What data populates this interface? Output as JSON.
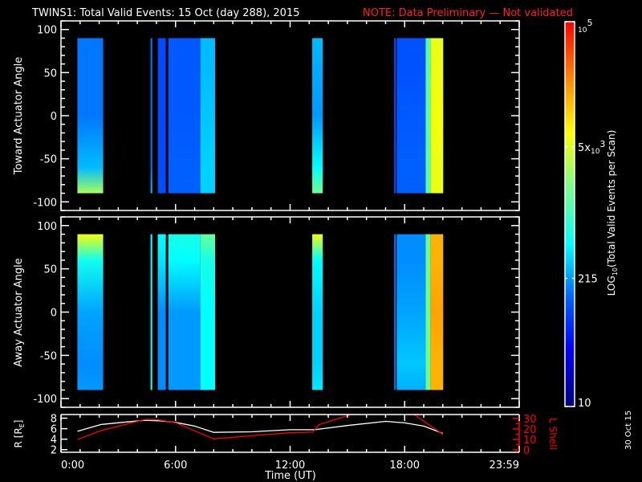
{
  "title": {
    "main": "TWINS1: Total Valid Events: 15 Oct (day 288), 2015",
    "note": "NOTE: Data Preliminary — Not validated",
    "note_color": "#ff2020"
  },
  "side_date": "30 Oct 15",
  "chart_data": [
    {
      "type": "heatmap",
      "panel": "toward",
      "ylabel": "Toward Actuator Angle",
      "ylim": [
        -110,
        110
      ],
      "yticks": [
        "100",
        "50",
        "0",
        "-50",
        "-100"
      ],
      "ytick_values": [
        100,
        50,
        0,
        -50,
        -100
      ],
      "xlim_hours": [
        0,
        24
      ],
      "profile_angles": [
        90,
        60,
        0,
        -60,
        -90
      ],
      "blocks": [
        {
          "start": 0.86,
          "end": 2.21,
          "levels": [
            0.3,
            0.3,
            0.3,
            0.36,
            0.62
          ]
        },
        {
          "start": 4.69,
          "end": 4.78,
          "levels": [
            0.3,
            0.3,
            0.3,
            0.3,
            0.36
          ]
        },
        {
          "start": 5.07,
          "end": 5.49,
          "levels": [
            0.25,
            0.25,
            0.25,
            0.25,
            0.26
          ]
        },
        {
          "start": 5.62,
          "end": 7.3,
          "levels": [
            0.27,
            0.27,
            0.27,
            0.28,
            0.28
          ]
        },
        {
          "start": 7.3,
          "end": 8.07,
          "levels": [
            0.36,
            0.36,
            0.37,
            0.38,
            0.38
          ]
        },
        {
          "start": 13.16,
          "end": 13.71,
          "levels": [
            0.36,
            0.35,
            0.33,
            0.42,
            0.56
          ]
        },
        {
          "start": 17.45,
          "end": 17.53,
          "levels": [
            0.26,
            0.26,
            0.26,
            0.26,
            0.26
          ]
        },
        {
          "start": 17.58,
          "end": 19.1,
          "levels": [
            0.26,
            0.26,
            0.27,
            0.28,
            0.28
          ]
        },
        {
          "start": 19.1,
          "end": 19.35,
          "levels": [
            0.52,
            0.52,
            0.52,
            0.52,
            0.52
          ]
        },
        {
          "start": 19.35,
          "end": 20.02,
          "levels": [
            0.69,
            0.69,
            0.7,
            0.69,
            0.69
          ]
        }
      ]
    },
    {
      "type": "heatmap",
      "panel": "away",
      "ylabel": "Away Actuator Angle",
      "ylim": [
        -110,
        110
      ],
      "yticks": [
        "100",
        "50",
        "0",
        "-50",
        "-100"
      ],
      "ytick_values": [
        100,
        50,
        0,
        -50,
        -100
      ],
      "xlim_hours": [
        0,
        24
      ],
      "profile_angles": [
        90,
        60,
        0,
        -60,
        -90
      ],
      "blocks": [
        {
          "start": 0.86,
          "end": 2.21,
          "levels": [
            0.7,
            0.44,
            0.34,
            0.32,
            0.33
          ]
        },
        {
          "start": 4.69,
          "end": 4.78,
          "levels": [
            0.42,
            0.42,
            0.42,
            0.42,
            0.45
          ]
        },
        {
          "start": 5.07,
          "end": 5.49,
          "levels": [
            0.42,
            0.4,
            0.32,
            0.32,
            0.32
          ]
        },
        {
          "start": 5.62,
          "end": 7.3,
          "levels": [
            0.45,
            0.42,
            0.33,
            0.33,
            0.33
          ]
        },
        {
          "start": 7.3,
          "end": 8.07,
          "levels": [
            0.55,
            0.45,
            0.42,
            0.42,
            0.42
          ]
        },
        {
          "start": 13.16,
          "end": 13.71,
          "levels": [
            0.7,
            0.42,
            0.38,
            0.38,
            0.4
          ]
        },
        {
          "start": 17.45,
          "end": 17.53,
          "levels": [
            0.3,
            0.3,
            0.3,
            0.3,
            0.3
          ]
        },
        {
          "start": 17.58,
          "end": 19.1,
          "levels": [
            0.32,
            0.32,
            0.34,
            0.37,
            0.35
          ]
        },
        {
          "start": 19.1,
          "end": 19.35,
          "levels": [
            0.55,
            0.55,
            0.55,
            0.55,
            0.55
          ]
        },
        {
          "start": 19.35,
          "end": 20.02,
          "levels": [
            0.8,
            0.8,
            0.82,
            0.8,
            0.8
          ]
        }
      ]
    },
    {
      "type": "line",
      "panel": "orbit",
      "xlabel": "Time (UT)",
      "xticks": [
        "0:00",
        "6:00",
        "12:00",
        "18:00",
        "23:59"
      ],
      "xtick_hours": [
        0,
        6,
        12,
        18,
        24
      ],
      "left_axis": {
        "label": "R [R",
        "label_sub": "E",
        "label_end": "]",
        "ticks": [
          "8",
          "6",
          "4",
          "2"
        ],
        "tick_values": [
          8,
          6,
          4,
          2
        ],
        "ylim": [
          1.5,
          8.7
        ]
      },
      "right_axis": {
        "label": "L Shell",
        "ticks": [
          "30",
          "20",
          "10",
          "0"
        ],
        "tick_values": [
          30,
          20,
          10,
          0
        ],
        "ylim": [
          -2.3,
          33.8
        ],
        "color": "#ff0000"
      },
      "series": [
        {
          "name": "R",
          "color": "#ffffff",
          "axis": "left",
          "x": [
            0.86,
            2.1,
            3.2,
            4.4,
            5.2,
            6.0,
            7.0,
            8.0,
            10.0,
            12.0,
            13.3,
            15.0,
            17.0,
            18.0,
            19.0,
            20.0
          ],
          "y": [
            5.5,
            6.8,
            7.2,
            7.6,
            7.5,
            7.2,
            6.5,
            5.3,
            5.4,
            5.8,
            5.8,
            6.6,
            7.4,
            7.1,
            6.5,
            5.1
          ]
        },
        {
          "name": "L Shell",
          "color": "#ff0000",
          "axis": "right",
          "segments": [
            {
              "x": [
                0.86,
                2.1,
                4.4,
                5.0,
                6.0,
                8.0,
                10.0,
                12.0,
                13.19,
                13.5,
                15.2,
                16.0
              ],
              "y": [
                9.8,
                18.5,
                29.0,
                29.0,
                26.0,
                10.5,
                13.5,
                16.4,
                17.0,
                24.0,
                33.8,
                40.0
              ]
            },
            {
              "x": [
                18.0,
                18.5,
                20.0
              ],
              "y": [
                40.0,
                33.8,
                14.8
              ]
            }
          ]
        }
      ]
    }
  ],
  "colorbar": {
    "label": "LOG",
    "label_sub": "10",
    "label_rest": "(Total Valid Events per Scan)",
    "scale": "log",
    "range": [
      10,
      100000
    ],
    "ticks": [
      {
        "value": 100000,
        "base": "10",
        "exp": "5",
        "prefix": ""
      },
      {
        "value": 5000,
        "base": "10",
        "exp": "3",
        "prefix": "5x"
      },
      {
        "value": 215,
        "text": "215"
      },
      {
        "value": 10,
        "text": "10"
      }
    ],
    "colormap": [
      {
        "pos": 0.0,
        "color": "#00007a"
      },
      {
        "pos": 0.15,
        "color": "#0000ff"
      },
      {
        "pos": 0.28,
        "color": "#0060ff"
      },
      {
        "pos": 0.42,
        "color": "#00ffff"
      },
      {
        "pos": 0.58,
        "color": "#80ff80"
      },
      {
        "pos": 0.71,
        "color": "#ffff00"
      },
      {
        "pos": 0.86,
        "color": "#ff8000"
      },
      {
        "pos": 1.0,
        "color": "#ff0000"
      }
    ]
  }
}
